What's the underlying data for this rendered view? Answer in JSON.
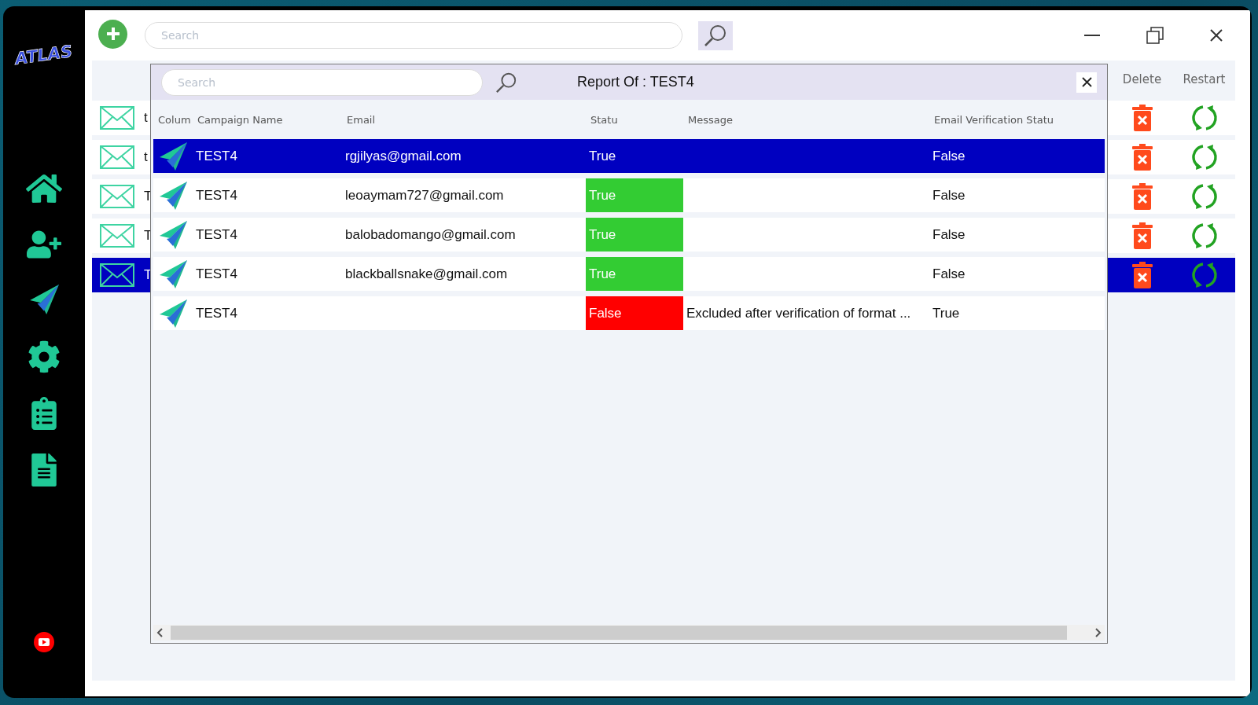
{
  "sidebar": {
    "logo": "ATLAS"
  },
  "toolbar": {
    "search": {
      "placeholder": "Search"
    }
  },
  "campaigns": {
    "columns": [
      "Delete",
      "Restart"
    ],
    "rows": [
      {
        "name": "t",
        "selected": false
      },
      {
        "name": "t",
        "selected": false
      },
      {
        "name": "T",
        "selected": false
      },
      {
        "name": "T",
        "selected": false
      },
      {
        "name": "T",
        "selected": true
      }
    ]
  },
  "report": {
    "title": "Report Of : TEST4",
    "search": {
      "placeholder": "Search"
    },
    "columns": [
      "Colum",
      "Campaign Name",
      "Email",
      "Statu",
      "Message",
      "Email Verification Statu"
    ],
    "rows": [
      {
        "campaign": "TEST4",
        "email": "rgjilyas@gmail.com",
        "status": {
          "text": "True"
        },
        "verification": "False",
        "selected": true
      },
      {
        "campaign": "TEST4",
        "email": "leoaymam727@gmail.com",
        "status": {
          "text": "True",
          "color": "#33cc33"
        },
        "verification": "False",
        "selected": false
      },
      {
        "campaign": "TEST4",
        "email": "balobadomango@gmail.com",
        "status": {
          "text": "True",
          "color": "#33cc33"
        },
        "verification": "False",
        "selected": false
      },
      {
        "campaign": "TEST4",
        "email": "blackballsnake@gmail.com",
        "status": {
          "text": "True",
          "color": "#33cc33"
        },
        "verification": "False",
        "selected": false
      },
      {
        "campaign": "TEST4",
        "status": {
          "text": "False",
          "color": "#ff0000"
        },
        "message": "Excluded after verification of format ...",
        "verification": "True",
        "selected": false
      }
    ]
  }
}
